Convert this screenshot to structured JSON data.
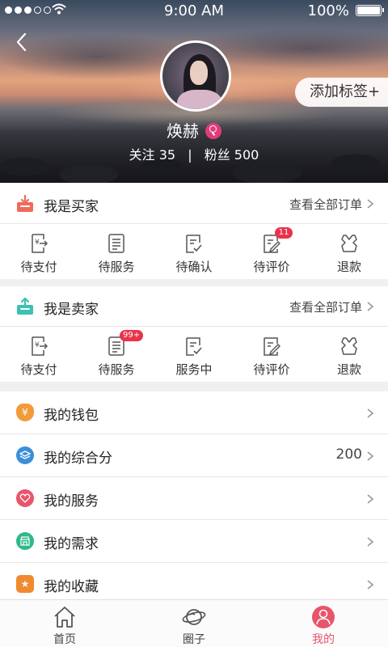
{
  "status_bar": {
    "time": "9:00 AM",
    "battery": "100%"
  },
  "profile": {
    "tag_button": "添加标签+",
    "name": "焕赫",
    "following_label": "关注",
    "following_count": "35",
    "separator": "|",
    "fans_label": "粉丝",
    "fans_count": "500"
  },
  "buyer": {
    "title": "我是买家",
    "view_all": "查看全部订单",
    "items": [
      {
        "label": "待支付",
        "badge": ""
      },
      {
        "label": "待服务",
        "badge": ""
      },
      {
        "label": "待确认",
        "badge": ""
      },
      {
        "label": "待评价",
        "badge": "11"
      },
      {
        "label": "退款",
        "badge": ""
      }
    ]
  },
  "seller": {
    "title": "我是卖家",
    "view_all": "查看全部订单",
    "items": [
      {
        "label": "待支付",
        "badge": ""
      },
      {
        "label": "待服务",
        "badge": "99+"
      },
      {
        "label": "服务中",
        "badge": ""
      },
      {
        "label": "待评价",
        "badge": ""
      },
      {
        "label": "退款",
        "badge": ""
      }
    ]
  },
  "menu": [
    {
      "label": "我的钱包",
      "value": ""
    },
    {
      "label": "我的综合分",
      "value": "200"
    },
    {
      "label": "我的服务",
      "value": ""
    },
    {
      "label": "我的需求",
      "value": ""
    },
    {
      "label": "我的收藏",
      "value": ""
    }
  ],
  "tabs": [
    {
      "label": "首页"
    },
    {
      "label": "圈子"
    },
    {
      "label": "我的"
    }
  ],
  "colors": {
    "accent": "#e8556b",
    "badge": "#e8334a",
    "buyer_icon": "#ef6a5a",
    "seller_icon": "#3cc1b3",
    "wallet": "#f39a3a",
    "score": "#3a8fd9",
    "service": "#e8556b",
    "demand": "#2fb98b",
    "favorite": "#f08a2e"
  }
}
